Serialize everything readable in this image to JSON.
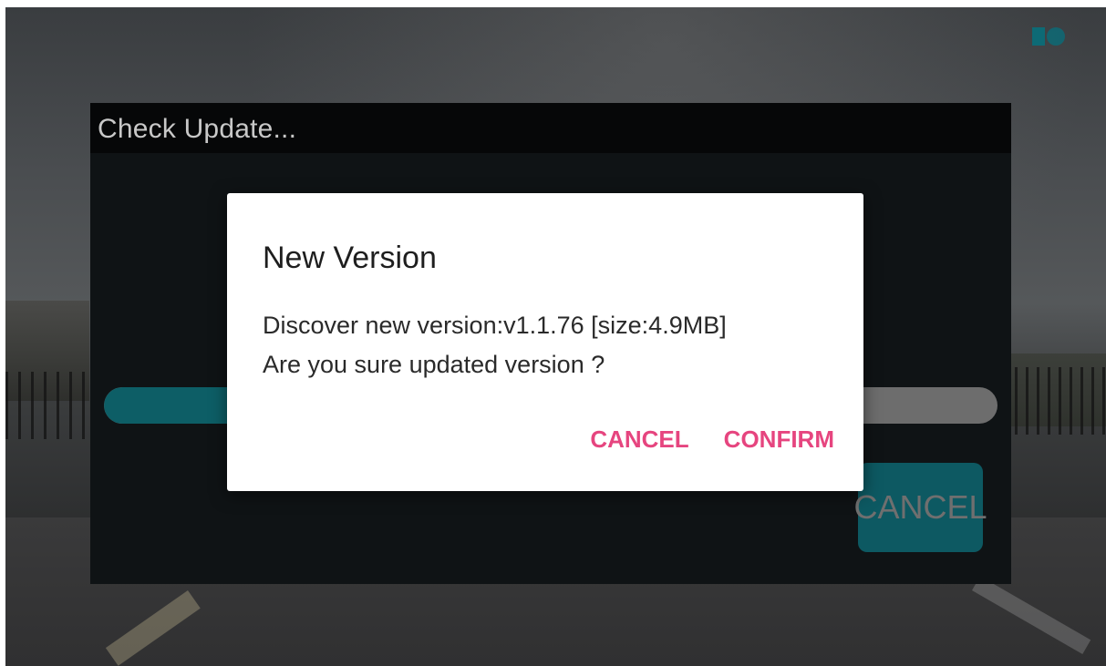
{
  "update_panel": {
    "title": "Check Update...",
    "progress_fraction": 0.14,
    "cancel_label": "CANCEL"
  },
  "dialog": {
    "title": "New Version",
    "message_lines": [
      "Discover new version:v1.1.76 [size:4.9MB]",
      "Are you sure updated version ?"
    ],
    "cancel_label": "CANCEL",
    "confirm_label": "CONFIRM"
  },
  "colors": {
    "accent": "#e6457f",
    "teal": "#0d5962"
  },
  "icons": {
    "corner_logo": "brand-logo-icon"
  }
}
